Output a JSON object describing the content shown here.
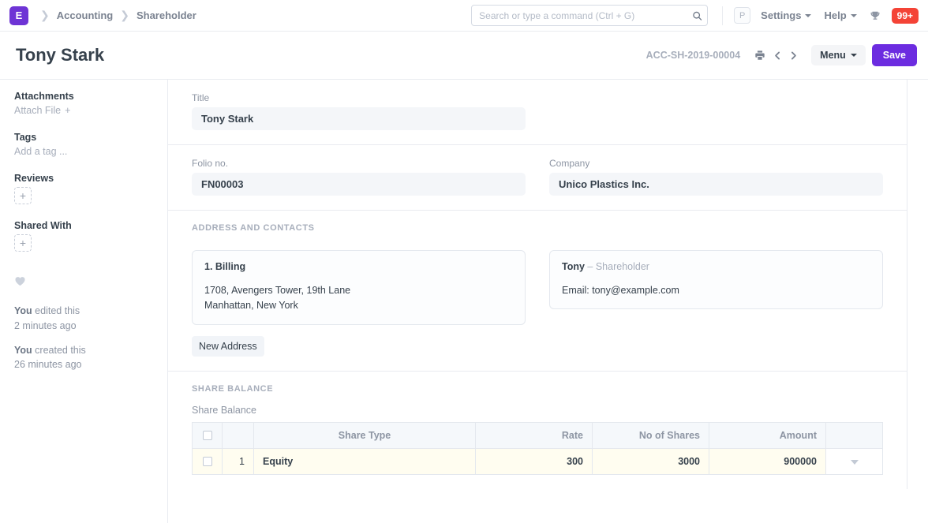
{
  "navbar": {
    "logo_letter": "E",
    "breadcrumbs": [
      "Accounting",
      "Shareholder"
    ],
    "search": {
      "placeholder": "Search or type a command (Ctrl + G)",
      "value": ""
    },
    "avatar_letter": "P",
    "settings_label": "Settings",
    "help_label": "Help",
    "notification_count": "99+",
    "badge_color": "#f44336",
    "brand_color": "#6e34d5"
  },
  "pagehead": {
    "title": "Tony Stark",
    "doc_id": "ACC-SH-2019-00004",
    "menu_label": "Menu",
    "save_label": "Save",
    "primary_color": "#6c2ce0"
  },
  "sidebar": {
    "attachments_heading": "Attachments",
    "attach_file_label": "Attach File",
    "tags_heading": "Tags",
    "add_tag_label": "Add a tag ...",
    "reviews_heading": "Reviews",
    "shared_with_heading": "Shared With",
    "plus_label": "+",
    "edited_by": "You",
    "edited_text": "edited this",
    "edited_time": "2 minutes ago",
    "created_by": "You",
    "created_text": "created this",
    "created_time": "26 minutes ago"
  },
  "form": {
    "title_label": "Title",
    "title_value": "Tony Stark",
    "folio_label": "Folio no.",
    "folio_value": "FN00003",
    "company_label": "Company",
    "company_value": "Unico Plastics Inc.",
    "address_section_title": "ADDRESS AND CONTACTS",
    "address_card": {
      "title": "1. Billing",
      "line1": "1708, Avengers Tower, 19th Lane",
      "line2": "Manhattan, New York"
    },
    "contact_card": {
      "name": "Tony",
      "role": "– Shareholder",
      "email": "Email: tony@example.com"
    },
    "new_address_label": "New Address",
    "share_section_title": "SHARE BALANCE",
    "share_grid_label": "Share Balance"
  },
  "share_table": {
    "columns": [
      "Share Type",
      "Rate",
      "No of Shares",
      "Amount"
    ],
    "rows": [
      {
        "index": "1",
        "share_type": "Equity",
        "rate": "300",
        "no_of_shares": "3000",
        "amount": "900000"
      }
    ]
  }
}
